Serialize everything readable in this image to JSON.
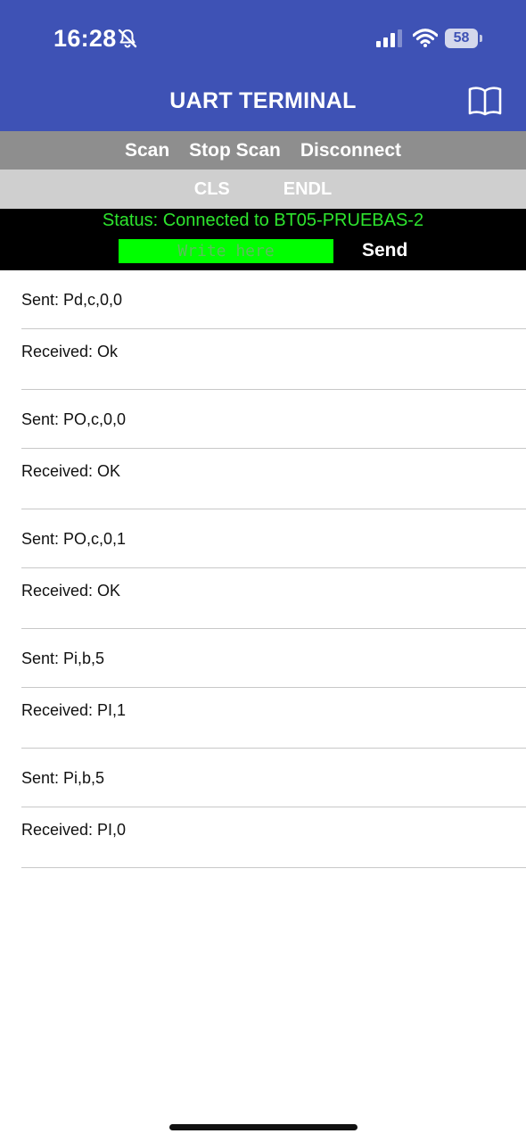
{
  "status_bar": {
    "time": "16:28",
    "battery": "58",
    "icons": [
      "bell-slash-icon",
      "signal-icon",
      "wifi-icon",
      "battery-icon"
    ]
  },
  "nav": {
    "title": "UART TERMINAL",
    "right_icon": "book-icon"
  },
  "toolbar": {
    "scan": "Scan",
    "stop_scan": "Stop Scan",
    "disconnect": "Disconnect"
  },
  "toolbar2": {
    "cls": "CLS",
    "endl": "ENDL"
  },
  "connection": {
    "status": "Status: Connected to BT05-PRUEBAS-2",
    "input_placeholder": "Write here",
    "input_value": "",
    "send_label": "Send"
  },
  "colors": {
    "header": "#3e52b5",
    "toolbar": "#8e8e8e",
    "toolbar2": "#cfcfcf",
    "status_bg": "#000000",
    "status_text": "#2ee52e",
    "input_bg": "#00ff00"
  },
  "messages": [
    {
      "text": "Sent: Pd,c,0,0"
    },
    {
      "text": "Received: Ok"
    },
    {
      "text": "Sent: PO,c,0,0"
    },
    {
      "text": "Received: OK"
    },
    {
      "text": "Sent: PO,c,0,1"
    },
    {
      "text": "Received: OK"
    },
    {
      "text": "Sent: Pi,b,5"
    },
    {
      "text": "Received: PI,1"
    },
    {
      "text": "Sent: Pi,b,5"
    },
    {
      "text": "Received: PI,0"
    }
  ]
}
